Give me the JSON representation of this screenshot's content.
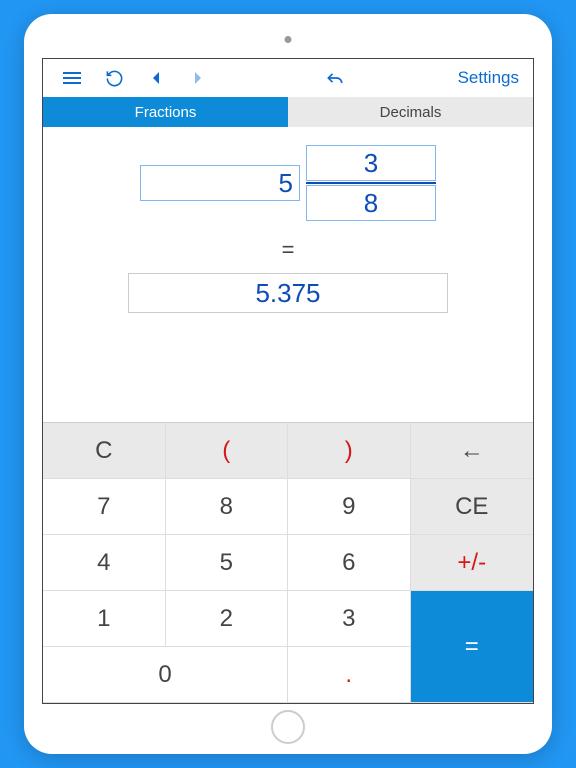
{
  "toolbar": {
    "settings_label": "Settings"
  },
  "tabs": {
    "fractions": "Fractions",
    "decimals": "Decimals",
    "active": "fractions"
  },
  "input": {
    "whole": "5",
    "numerator": "3",
    "denominator": "8"
  },
  "equals_sign": "=",
  "result": "5.375",
  "keypad": {
    "clear": "C",
    "lparen": "(",
    "rparen": ")",
    "backspace": "←",
    "d7": "7",
    "d8": "8",
    "d9": "9",
    "ce": "CE",
    "d4": "4",
    "d5": "5",
    "d6": "6",
    "plusminus": "+/-",
    "d1": "1",
    "d2": "2",
    "d3": "3",
    "equals": "=",
    "d0": "0",
    "dot": "."
  },
  "colors": {
    "accent": "#0d8bd9",
    "text_blue": "#0d4db4",
    "danger": "#d31919",
    "bg": "#2196f3"
  }
}
